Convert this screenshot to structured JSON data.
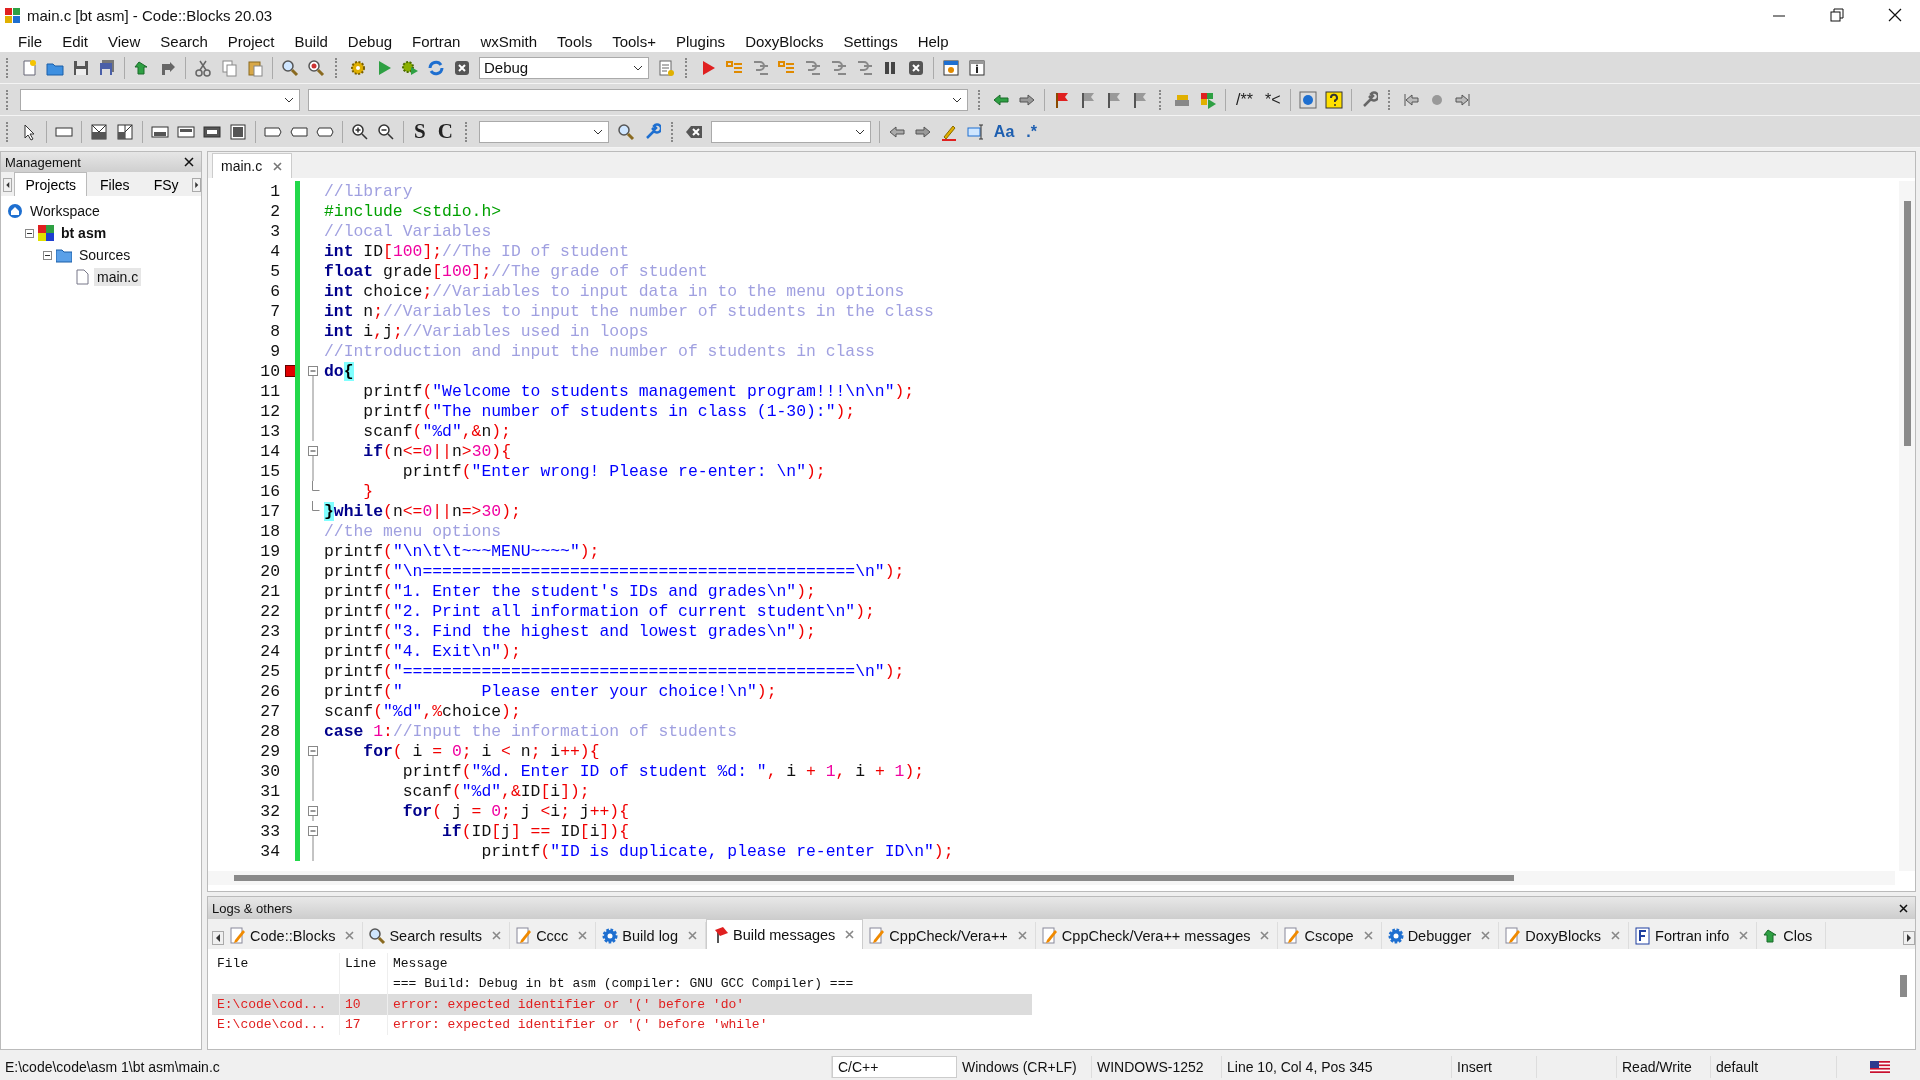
{
  "window": {
    "title": "main.c [bt asm] - Code::Blocks 20.03"
  },
  "menu": [
    "File",
    "Edit",
    "View",
    "Search",
    "Project",
    "Build",
    "Debug",
    "Fortran",
    "wxSmith",
    "Tools",
    "Tools+",
    "Plugins",
    "DoxyBlocks",
    "Settings",
    "Help"
  ],
  "toolbars": {
    "build_target": "Debug",
    "comment_buttons": [
      "/**",
      "*<"
    ],
    "letter_buttons": [
      "S",
      "C"
    ],
    "search_buttons": [
      "Aa",
      ".*"
    ]
  },
  "management": {
    "title": "Management",
    "tabs": [
      {
        "label": "Projects",
        "selected": true
      },
      {
        "label": "Files",
        "selected": false
      },
      {
        "label": "FSy",
        "selected": false
      }
    ],
    "tree": [
      {
        "label": "Workspace",
        "kind": "workspace",
        "bold": false,
        "selected": false,
        "children": [
          {
            "label": "bt asm",
            "kind": "project",
            "bold": true,
            "selected": false,
            "expanded": true,
            "children": [
              {
                "label": "Sources",
                "kind": "folder",
                "bold": false,
                "selected": false,
                "expanded": true,
                "children": [
                  {
                    "label": "main.c",
                    "kind": "file",
                    "bold": false,
                    "selected": true
                  }
                ]
              }
            ]
          }
        ]
      }
    ]
  },
  "editor": {
    "tabs": [
      {
        "label": "main.c",
        "selected": true
      }
    ],
    "lines": [
      {
        "number": "1",
        "marker": false,
        "tokens": [
          {
            "kind": "comment",
            "text": "//library"
          }
        ]
      },
      {
        "number": "2",
        "marker": false,
        "tokens": [
          {
            "kind": "preproc",
            "text": "#include <stdio.h>"
          }
        ]
      },
      {
        "number": "3",
        "marker": false,
        "tokens": [
          {
            "kind": "comment",
            "text": "//local Variables"
          }
        ]
      },
      {
        "number": "4",
        "marker": false,
        "tokens": [
          {
            "kind": "keyword",
            "text": "int"
          },
          {
            "kind": "plain",
            "text": " ID"
          },
          {
            "kind": "op",
            "text": "["
          },
          {
            "kind": "number",
            "text": "100"
          },
          {
            "kind": "op",
            "text": "];"
          },
          {
            "kind": "comment",
            "text": "//The ID of student"
          }
        ]
      },
      {
        "number": "5",
        "marker": false,
        "tokens": [
          {
            "kind": "keyword",
            "text": "float"
          },
          {
            "kind": "plain",
            "text": " grade"
          },
          {
            "kind": "op",
            "text": "["
          },
          {
            "kind": "number",
            "text": "100"
          },
          {
            "kind": "op",
            "text": "];"
          },
          {
            "kind": "comment",
            "text": "//The grade of student"
          }
        ]
      },
      {
        "number": "6",
        "marker": false,
        "tokens": [
          {
            "kind": "keyword",
            "text": "int"
          },
          {
            "kind": "plain",
            "text": " choice"
          },
          {
            "kind": "op",
            "text": ";"
          },
          {
            "kind": "comment",
            "text": "//Variables to input data in to the menu options"
          }
        ]
      },
      {
        "number": "7",
        "marker": false,
        "tokens": [
          {
            "kind": "keyword",
            "text": "int"
          },
          {
            "kind": "plain",
            "text": " n"
          },
          {
            "kind": "op",
            "text": ";"
          },
          {
            "kind": "comment",
            "text": "//Variables to input the number of students in the class"
          }
        ]
      },
      {
        "number": "8",
        "marker": false,
        "tokens": [
          {
            "kind": "keyword",
            "text": "int"
          },
          {
            "kind": "plain",
            "text": " i"
          },
          {
            "kind": "op",
            "text": ","
          },
          {
            "kind": "plain",
            "text": "j"
          },
          {
            "kind": "op",
            "text": ";"
          },
          {
            "kind": "comment",
            "text": "//Variables used in loops"
          }
        ]
      },
      {
        "number": "9",
        "marker": false,
        "tokens": [
          {
            "kind": "comment",
            "text": "//Introduction and input the number of students in class"
          }
        ]
      },
      {
        "number": "10",
        "marker": true,
        "fold_marker": {
          "kind": "start"
        },
        "tokens": [
          {
            "kind": "keyword",
            "text": "do"
          },
          {
            "kind": "brace",
            "text": "{"
          }
        ]
      },
      {
        "number": "11",
        "marker": false,
        "fold_marker": {
          "kind": "line"
        },
        "tokens": [
          {
            "kind": "plain",
            "text": "    printf"
          },
          {
            "kind": "op",
            "text": "("
          },
          {
            "kind": "string",
            "text": "\"Welcome to students management program!!!\\n\\n\""
          },
          {
            "kind": "op",
            "text": ");"
          }
        ]
      },
      {
        "number": "12",
        "marker": false,
        "fold_marker": {
          "kind": "line"
        },
        "tokens": [
          {
            "kind": "plain",
            "text": "    printf"
          },
          {
            "kind": "op",
            "text": "("
          },
          {
            "kind": "string",
            "text": "\"The number of students in class (1-30):\""
          },
          {
            "kind": "op",
            "text": ");"
          }
        ]
      },
      {
        "number": "13",
        "marker": false,
        "fold_marker": {
          "kind": "line"
        },
        "tokens": [
          {
            "kind": "plain",
            "text": "    scanf"
          },
          {
            "kind": "op",
            "text": "("
          },
          {
            "kind": "string",
            "text": "\"%d\""
          },
          {
            "kind": "op",
            "text": ",&"
          },
          {
            "kind": "plain",
            "text": "n"
          },
          {
            "kind": "op",
            "text": ");"
          }
        ]
      },
      {
        "number": "14",
        "marker": false,
        "fold_marker": {
          "kind": "start"
        },
        "tokens": [
          {
            "kind": "keyword",
            "text": "    if"
          },
          {
            "kind": "op",
            "text": "("
          },
          {
            "kind": "plain",
            "text": "n"
          },
          {
            "kind": "op",
            "text": "<="
          },
          {
            "kind": "number",
            "text": "0"
          },
          {
            "kind": "op",
            "text": "||"
          },
          {
            "kind": "plain",
            "text": "n"
          },
          {
            "kind": "op",
            "text": ">"
          },
          {
            "kind": "number",
            "text": "30"
          },
          {
            "kind": "op",
            "text": "){"
          }
        ]
      },
      {
        "number": "15",
        "marker": false,
        "fold_marker": {
          "kind": "line"
        },
        "tokens": [
          {
            "kind": "plain",
            "text": "        printf"
          },
          {
            "kind": "op",
            "text": "("
          },
          {
            "kind": "string",
            "text": "\"Enter wrong! Please re-enter: \\n\""
          },
          {
            "kind": "op",
            "text": ");"
          }
        ]
      },
      {
        "number": "16",
        "marker": false,
        "fold_marker": {
          "kind": "end"
        },
        "tokens": [
          {
            "kind": "op",
            "text": "    }"
          }
        ]
      },
      {
        "number": "17",
        "marker": false,
        "fold_marker": {
          "kind": "end"
        },
        "tokens": [
          {
            "kind": "brace",
            "text": "}"
          },
          {
            "kind": "keyword",
            "text": "while"
          },
          {
            "kind": "op",
            "text": "("
          },
          {
            "kind": "plain",
            "text": "n"
          },
          {
            "kind": "op",
            "text": "<="
          },
          {
            "kind": "number",
            "text": "0"
          },
          {
            "kind": "op",
            "text": "||"
          },
          {
            "kind": "plain",
            "text": "n"
          },
          {
            "kind": "op",
            "text": "=>"
          },
          {
            "kind": "number",
            "text": "30"
          },
          {
            "kind": "op",
            "text": ");"
          }
        ]
      },
      {
        "number": "18",
        "marker": false,
        "tokens": [
          {
            "kind": "comment",
            "text": "//the menu options"
          }
        ]
      },
      {
        "number": "19",
        "marker": false,
        "tokens": [
          {
            "kind": "plain",
            "text": "printf"
          },
          {
            "kind": "op",
            "text": "("
          },
          {
            "kind": "string",
            "text": "\"\\n\\t\\t~~~MENU~~~~\""
          },
          {
            "kind": "op",
            "text": ");"
          }
        ]
      },
      {
        "number": "20",
        "marker": false,
        "tokens": [
          {
            "kind": "plain",
            "text": "printf"
          },
          {
            "kind": "op",
            "text": "("
          },
          {
            "kind": "string",
            "text": "\"\\n============================================\\n\""
          },
          {
            "kind": "op",
            "text": ");"
          }
        ]
      },
      {
        "number": "21",
        "marker": false,
        "tokens": [
          {
            "kind": "plain",
            "text": "printf"
          },
          {
            "kind": "op",
            "text": "("
          },
          {
            "kind": "string",
            "text": "\"1. Enter the student's IDs and grades\\n\""
          },
          {
            "kind": "op",
            "text": ");"
          }
        ]
      },
      {
        "number": "22",
        "marker": false,
        "tokens": [
          {
            "kind": "plain",
            "text": "printf"
          },
          {
            "kind": "op",
            "text": "("
          },
          {
            "kind": "string",
            "text": "\"2. Print all information of current student\\n\""
          },
          {
            "kind": "op",
            "text": ");"
          }
        ]
      },
      {
        "number": "23",
        "marker": false,
        "tokens": [
          {
            "kind": "plain",
            "text": "printf"
          },
          {
            "kind": "op",
            "text": "("
          },
          {
            "kind": "string",
            "text": "\"3. Find the highest and lowest grades\\n\""
          },
          {
            "kind": "op",
            "text": ");"
          }
        ]
      },
      {
        "number": "24",
        "marker": false,
        "tokens": [
          {
            "kind": "plain",
            "text": "printf"
          },
          {
            "kind": "op",
            "text": "("
          },
          {
            "kind": "string",
            "text": "\"4. Exit\\n\""
          },
          {
            "kind": "op",
            "text": ");"
          }
        ]
      },
      {
        "number": "25",
        "marker": false,
        "tokens": [
          {
            "kind": "plain",
            "text": "printf"
          },
          {
            "kind": "op",
            "text": "("
          },
          {
            "kind": "string",
            "text": "\"==============================================\\n\""
          },
          {
            "kind": "op",
            "text": ");"
          }
        ]
      },
      {
        "number": "26",
        "marker": false,
        "tokens": [
          {
            "kind": "plain",
            "text": "printf"
          },
          {
            "kind": "op",
            "text": "("
          },
          {
            "kind": "string",
            "text": "\"        Please enter your choice!\\n\""
          },
          {
            "kind": "op",
            "text": ");"
          }
        ]
      },
      {
        "number": "27",
        "marker": false,
        "tokens": [
          {
            "kind": "plain",
            "text": "scanf"
          },
          {
            "kind": "op",
            "text": "("
          },
          {
            "kind": "string",
            "text": "\"%d\""
          },
          {
            "kind": "op",
            "text": ",%"
          },
          {
            "kind": "plain",
            "text": "choice"
          },
          {
            "kind": "op",
            "text": ");"
          }
        ]
      },
      {
        "number": "28",
        "marker": false,
        "tokens": [
          {
            "kind": "keyword",
            "text": "case "
          },
          {
            "kind": "number",
            "text": "1"
          },
          {
            "kind": "op",
            "text": ":"
          },
          {
            "kind": "comment",
            "text": "//Input the information of students"
          }
        ]
      },
      {
        "number": "29",
        "marker": false,
        "fold_marker": {
          "kind": "start"
        },
        "tokens": [
          {
            "kind": "keyword",
            "text": "    for"
          },
          {
            "kind": "op",
            "text": "("
          },
          {
            "kind": "plain",
            "text": " i "
          },
          {
            "kind": "op",
            "text": "= "
          },
          {
            "kind": "number",
            "text": "0"
          },
          {
            "kind": "op",
            "text": ";"
          },
          {
            "kind": "plain",
            "text": " i "
          },
          {
            "kind": "op",
            "text": "<"
          },
          {
            "kind": "plain",
            "text": " n"
          },
          {
            "kind": "op",
            "text": ";"
          },
          {
            "kind": "plain",
            "text": " i"
          },
          {
            "kind": "op",
            "text": "++){"
          }
        ]
      },
      {
        "number": "30",
        "marker": false,
        "fold_marker": {
          "kind": "line"
        },
        "tokens": [
          {
            "kind": "plain",
            "text": "        printf"
          },
          {
            "kind": "op",
            "text": "("
          },
          {
            "kind": "string",
            "text": "\"%d. Enter ID of student %d: \""
          },
          {
            "kind": "op",
            "text": ","
          },
          {
            "kind": "plain",
            "text": " i "
          },
          {
            "kind": "op",
            "text": "+ "
          },
          {
            "kind": "number",
            "text": "1"
          },
          {
            "kind": "op",
            "text": ","
          },
          {
            "kind": "plain",
            "text": " i "
          },
          {
            "kind": "op",
            "text": "+ "
          },
          {
            "kind": "number",
            "text": "1"
          },
          {
            "kind": "op",
            "text": ");"
          }
        ]
      },
      {
        "number": "31",
        "marker": false,
        "fold_marker": {
          "kind": "line"
        },
        "tokens": [
          {
            "kind": "plain",
            "text": "        scanf"
          },
          {
            "kind": "op",
            "text": "("
          },
          {
            "kind": "string",
            "text": "\"%d\""
          },
          {
            "kind": "op",
            "text": ",&"
          },
          {
            "kind": "plain",
            "text": "ID"
          },
          {
            "kind": "op",
            "text": "["
          },
          {
            "kind": "plain",
            "text": "i"
          },
          {
            "kind": "op",
            "text": "]);"
          }
        ]
      },
      {
        "number": "32",
        "marker": false,
        "fold_marker": {
          "kind": "start"
        },
        "tokens": [
          {
            "kind": "keyword",
            "text": "        for"
          },
          {
            "kind": "op",
            "text": "("
          },
          {
            "kind": "plain",
            "text": " j "
          },
          {
            "kind": "op",
            "text": "= "
          },
          {
            "kind": "number",
            "text": "0"
          },
          {
            "kind": "op",
            "text": ";"
          },
          {
            "kind": "plain",
            "text": " j "
          },
          {
            "kind": "op",
            "text": "<"
          },
          {
            "kind": "plain",
            "text": "i"
          },
          {
            "kind": "op",
            "text": ";"
          },
          {
            "kind": "plain",
            "text": " j"
          },
          {
            "kind": "op",
            "text": "++){"
          }
        ]
      },
      {
        "number": "33",
        "marker": false,
        "fold_marker": {
          "kind": "start"
        },
        "tokens": [
          {
            "kind": "keyword",
            "text": "            if"
          },
          {
            "kind": "op",
            "text": "("
          },
          {
            "kind": "plain",
            "text": "ID"
          },
          {
            "kind": "op",
            "text": "["
          },
          {
            "kind": "plain",
            "text": "j"
          },
          {
            "kind": "op",
            "text": "] =="
          },
          {
            "kind": "plain",
            "text": " ID"
          },
          {
            "kind": "op",
            "text": "["
          },
          {
            "kind": "plain",
            "text": "i"
          },
          {
            "kind": "op",
            "text": "]){"
          }
        ]
      },
      {
        "number": "34",
        "marker": false,
        "fold_marker": {
          "kind": "line"
        },
        "tokens": [
          {
            "kind": "plain",
            "text": "                printf"
          },
          {
            "kind": "op",
            "text": "("
          },
          {
            "kind": "string",
            "text": "\"ID is duplicate, please re-enter ID\\n\""
          },
          {
            "kind": "op",
            "text": ");"
          }
        ]
      }
    ]
  },
  "logs": {
    "title": "Logs & others",
    "tabs": [
      {
        "label": "Code::Blocks",
        "selected": false
      },
      {
        "label": "Search results",
        "selected": false
      },
      {
        "label": "Cccc",
        "selected": false
      },
      {
        "label": "Build log",
        "selected": false
      },
      {
        "label": "Build messages",
        "selected": true
      },
      {
        "label": "CppCheck/Vera++",
        "selected": false
      },
      {
        "label": "CppCheck/Vera++ messages",
        "selected": false
      },
      {
        "label": "Cscope",
        "selected": false
      },
      {
        "label": "Debugger",
        "selected": false
      },
      {
        "label": "DoxyBlocks",
        "selected": false
      },
      {
        "label": "Fortran info",
        "selected": false
      },
      {
        "label": "Clos",
        "selected": false
      }
    ],
    "columns": [
      "File",
      "Line",
      "Message"
    ],
    "rows": [
      {
        "kind": "info",
        "selected": false,
        "cells": [
          "",
          "",
          "=== Build: Debug in bt asm (compiler: GNU GCC Compiler) ==="
        ]
      },
      {
        "kind": "error",
        "selected": true,
        "cells": [
          "E:\\code\\cod...",
          "10",
          "error: expected identifier or '(' before 'do'"
        ]
      },
      {
        "kind": "error",
        "selected": false,
        "cells": [
          "E:\\code\\cod...",
          "17",
          "error: expected identifier or '(' before 'while'"
        ]
      }
    ]
  },
  "status_bar": {
    "path": "E:\\code\\code\\asm 1\\bt asm\\main.c",
    "language": "C/C++",
    "line_endings": "Windows (CR+LF)",
    "encoding": "WINDOWS-1252",
    "position": "Line 10, Col 4, Pos 345",
    "mode": "Insert",
    "access": "Read/Write",
    "theme": "default"
  }
}
